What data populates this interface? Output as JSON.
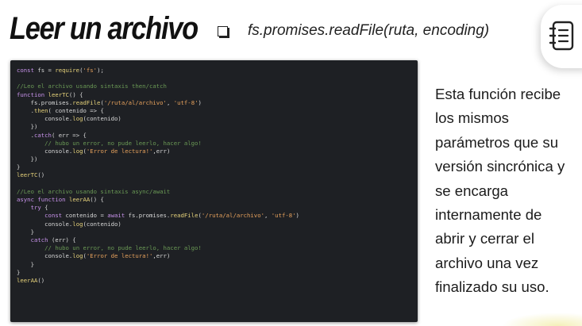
{
  "slide": {
    "title": "Leer un archivo",
    "subtitle": "fs.promises.readFile(ruta, encoding)",
    "description_lines": [
      "Esta función recibe",
      "los mismos",
      "parámetros que su",
      "versión sincrónica y",
      "se encarga",
      "internamente de",
      "abrir y cerrar el",
      "archivo una vez",
      "finalizado su uso."
    ],
    "icon": "notebook-icon"
  },
  "code": {
    "lines": [
      "const fs = require('fs');",
      "",
      "//Leo el archivo usando sintaxis then/catch",
      "function leerTC() {",
      "    fs.promises.readFile('/ruta/al/archivo', 'utf-8')",
      "    .then( contenido => {",
      "        console.log(contenido)",
      "    })",
      "    .catch( err => {",
      "        // hubo un error, no pude leerlo, hacer algo!",
      "        console.log('Error de lectura!',err)",
      "    })",
      "}",
      "leerTC()",
      "",
      "//Leo el archivo usando sintaxis async/await",
      "async function leerAA() {",
      "    try {",
      "        const contenido = await fs.promises.readFile('/ruta/al/archivo', 'utf-8')",
      "        console.log(contenido)",
      "    }",
      "    catch (err) {",
      "        // hubo un error, no pude leerlo, hacer algo!",
      "        console.log('Error de lectura!',err)",
      "    }",
      "}",
      "leerAA()"
    ]
  },
  "colors": {
    "code_background": "#1e2024",
    "keyword": "#c792ea",
    "comment": "#6a9955",
    "string": "#e6a15c",
    "function": "#e6d27a"
  }
}
